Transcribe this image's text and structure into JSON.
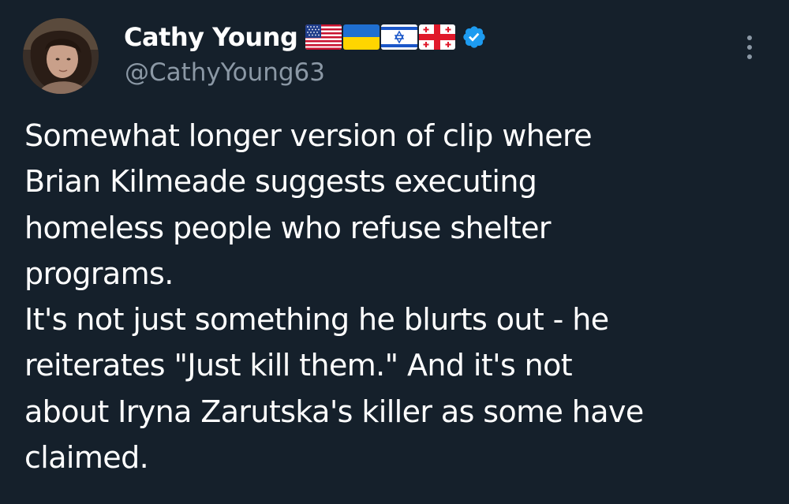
{
  "author": {
    "display_name": "Cathy Young",
    "handle": "@CathyYoung63",
    "flags": [
      "us-flag-icon",
      "ukraine-flag-icon",
      "israel-flag-icon",
      "georgia-flag-icon"
    ],
    "verified": true
  },
  "tweet": {
    "lines": [
      "Somewhat longer version of clip where",
      "Brian Kilmeade suggests executing",
      "homeless people who refuse shelter",
      "programs.",
      "It's not just something he blurts out - he",
      "reiterates \"Just kill them.\" And it's not",
      "about Iryna Zarutska's killer as some have",
      "claimed."
    ]
  },
  "colors": {
    "background": "#15202b",
    "text_primary": "#ffffff",
    "text_secondary": "#8b98a5",
    "verified_blue": "#1d9bf0"
  }
}
